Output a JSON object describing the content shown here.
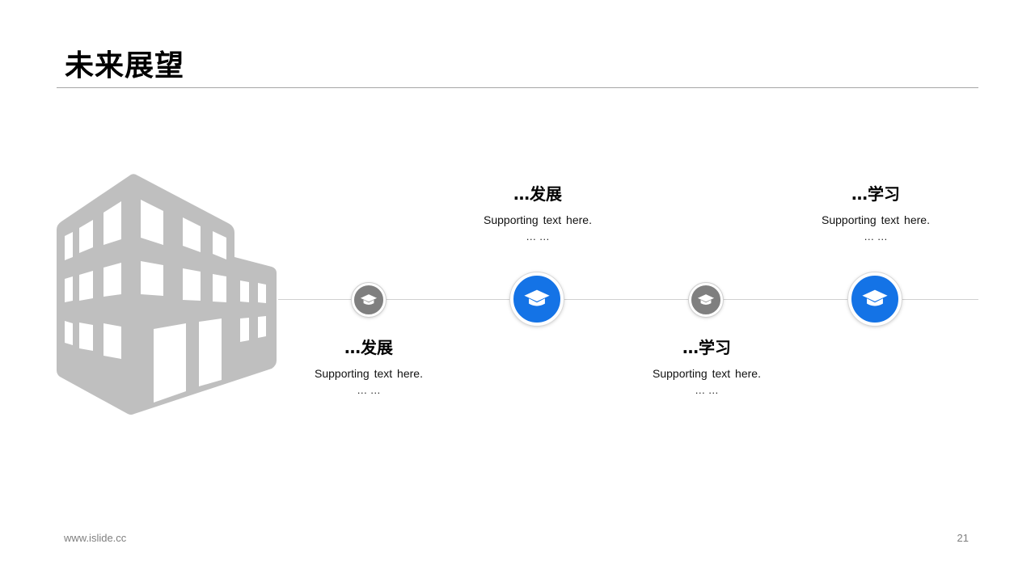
{
  "title": "未来展望",
  "milestones": [
    {
      "heading": "…发展",
      "text": "Supporting  text here.",
      "dots": "… …",
      "size": "small",
      "color": "#7f7f7f"
    },
    {
      "heading": "…发展",
      "text": "Supporting  text here.",
      "dots": "… …",
      "size": "large",
      "color": "#1473e6"
    },
    {
      "heading": "…学习",
      "text": "Supporting  text here.",
      "dots": "… …",
      "size": "small",
      "color": "#7f7f7f"
    },
    {
      "heading": "…学习",
      "text": "Supporting  text here.",
      "dots": "… …",
      "size": "large",
      "color": "#1473e6"
    }
  ],
  "icons": {
    "node": "graduation-cap-icon",
    "illustration": "building-icon"
  },
  "colors": {
    "accent": "#1473e6",
    "neutral": "#7f7f7f",
    "building": "#bfbfbf"
  },
  "footer": {
    "website": "www.islide.cc",
    "page_number": "21"
  }
}
